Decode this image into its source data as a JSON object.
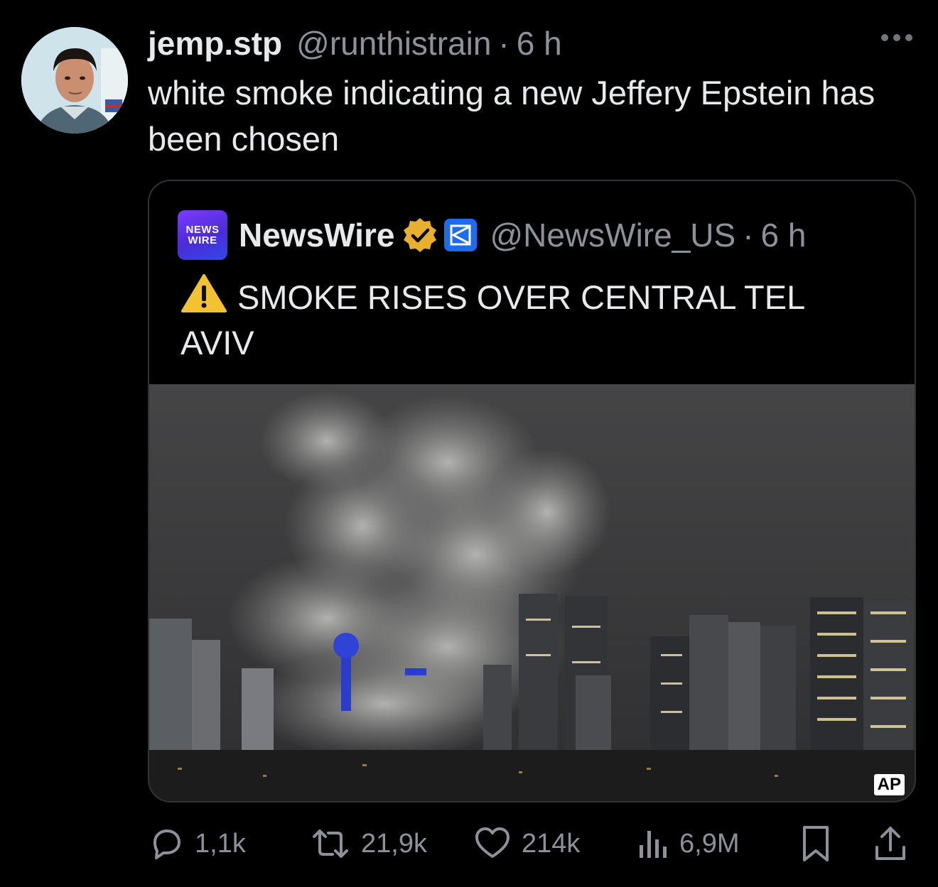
{
  "tweet": {
    "author": {
      "display_name": "jemp.stp",
      "handle": "@runthistrain",
      "time": "6 h",
      "avatar_icon": "profile-photo"
    },
    "separator": "·",
    "text": "white smoke indicating a new Jeffery Epstein has been chosen",
    "more_icon": "more-horizontal-icon"
  },
  "quoted": {
    "logo_text_line1": "NEWS",
    "logo_text_line2": "WIRE",
    "display_name": "NewsWire",
    "verified_icon": "gold-verified-badge-icon",
    "affiliation_icon": "affiliate-badge-icon",
    "handle": "@NewsWire_US",
    "separator": "·",
    "time": "6 h",
    "warning_icon": "warning-icon",
    "text": "SMOKE RISES OVER CENTRAL TEL AVIV",
    "media_credit": "AP"
  },
  "actions": {
    "replies": "1,1k",
    "retweets": "21,9k",
    "likes": "214k",
    "views": "6,9M",
    "bookmark_icon": "bookmark-icon",
    "share_icon": "share-icon"
  },
  "colors": {
    "background": "#000000",
    "text_primary": "#e7e9ea",
    "text_secondary": "#8b9299",
    "verified_gold": "#e8b02c",
    "affiliate_blue": "#1d6cf0",
    "newswire_purple": "#6c34f0"
  }
}
